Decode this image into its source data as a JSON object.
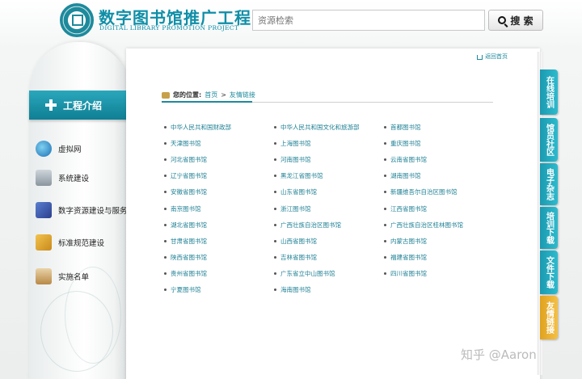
{
  "header": {
    "brand_cn": "数字图书馆推广工程",
    "brand_en": "DIGITAL LIBRARY PROMOTION PROJECT",
    "search_placeholder": "资源检索",
    "search_button": "搜 索"
  },
  "sidebar": {
    "title": "工程介绍",
    "items": [
      {
        "label": "虚拟网",
        "icon": "globe-icon"
      },
      {
        "label": "系统建设",
        "icon": "server-icon"
      },
      {
        "label": "数字资源建设与服务",
        "icon": "monitor-icon"
      },
      {
        "label": "标准规范建设",
        "icon": "blocks-icon"
      },
      {
        "label": "实施名单",
        "icon": "clipboard-icon"
      }
    ]
  },
  "main": {
    "home_link": "返回首页",
    "breadcrumb": {
      "label": "您的位置:",
      "home": "首页",
      "separator": ">",
      "current": "友情链接"
    },
    "links": [
      "中华人民共和国财政部",
      "中华人民共和国文化和旅游部",
      "首都图书馆",
      "天津图书馆",
      "上海图书馆",
      "重庆图书馆",
      "河北省图书馆",
      "河南图书馆",
      "云南省图书馆",
      "辽宁省图书馆",
      "黑龙江省图书馆",
      "湖南图书馆",
      "安徽省图书馆",
      "山东省图书馆",
      "新疆维吾尔自治区图书馆",
      "南京图书馆",
      "浙江图书馆",
      "江西省图书馆",
      "湖北省图书馆",
      "广西壮族自治区图书馆",
      "广西壮族自治区桂林图书馆",
      "甘肃省图书馆",
      "山西省图书馆",
      "内蒙古图书馆",
      "陕西省图书馆",
      "吉林省图书馆",
      "福建省图书馆",
      "贵州省图书馆",
      "广东省立中山图书馆",
      "四川省图书馆",
      "宁夏图书馆",
      "海南图书馆"
    ]
  },
  "side_tabs": [
    {
      "label": "在线培训",
      "active": false
    },
    {
      "label": "馆员社区",
      "active": false
    },
    {
      "label": "电子杂志",
      "active": false
    },
    {
      "label": "培训下载",
      "active": false
    },
    {
      "label": "文件下载",
      "active": false
    },
    {
      "label": "友情链接",
      "active": true
    }
  ],
  "watermark": "知乎 @Aaron",
  "colors": {
    "accent": "#1d8a9c",
    "active_tab": "#e0a21f"
  }
}
